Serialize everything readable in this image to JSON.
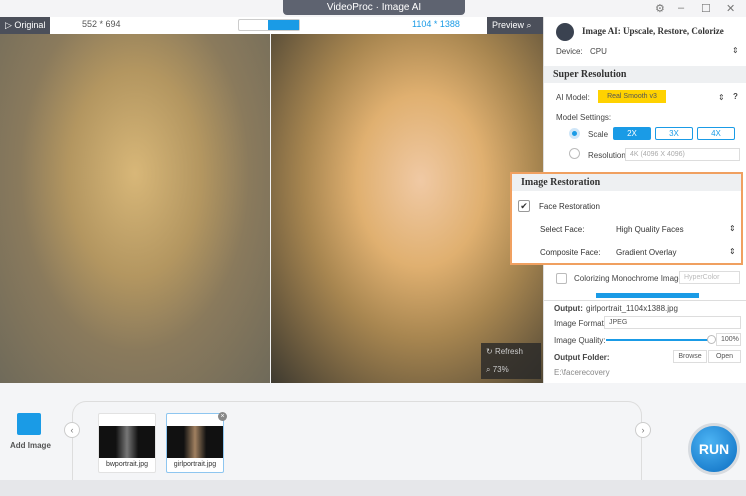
{
  "window": {
    "title": "VideoProc · Image AI",
    "settings_icon": "gear-icon",
    "minimize": "–",
    "maximize": "☐",
    "close": "✕"
  },
  "viewer": {
    "original_tab": "▷ Original",
    "original_size": "552 * 694",
    "output_size": "1104 * 1388",
    "preview_tab": "Preview",
    "refresh": "Refresh",
    "zoom": "73%"
  },
  "panel": {
    "title": "Image AI: Upscale, Restore, Colorize",
    "device_label": "Device:",
    "device_value": "CPU",
    "super_resolution": {
      "heading": "Super Resolution",
      "ai_model_label": "AI Model:",
      "ai_model_value": "Real Smooth v3",
      "help": "?",
      "model_settings_label": "Model Settings:",
      "scale_label": "Scale",
      "scale_options": [
        "2X",
        "3X",
        "4X"
      ],
      "scale_selected": "2X",
      "resolution_label": "Resolution",
      "resolution_value": "4K (4096 X 4096)"
    },
    "image_restoration": {
      "heading": "Image Restoration",
      "face_restoration_label": "Face Restoration",
      "face_restoration_checked": true,
      "select_face_label": "Select Face:",
      "select_face_value": "High Quality Faces",
      "composite_face_label": "Composite Face:",
      "composite_face_value": "Gradient Overlay"
    },
    "colorize": {
      "label": "Colorizing Monochrome Image:",
      "value": "HyperColor",
      "checked": false
    },
    "output": {
      "label": "Output:",
      "filename": "girlportrait_1104x1388.jpg",
      "format_label": "Image Format:",
      "format_value": "JPEG",
      "quality_label": "Image Quality:",
      "quality_value": "100%",
      "quality_percent": 100,
      "folder_label": "Output Folder:",
      "browse": "Browse",
      "open": "Open",
      "folder_path": "E:\\facerecovery"
    }
  },
  "bottom": {
    "add_image": "Add Image",
    "files": [
      "bwportrait.jpg",
      "girlportrait.jpg"
    ],
    "selected_file": "girlportrait.jpg",
    "run": "RUN"
  },
  "colors": {
    "accent": "#1a9be6",
    "highlight": "#ffd200",
    "restore_border": "#f0a060"
  }
}
